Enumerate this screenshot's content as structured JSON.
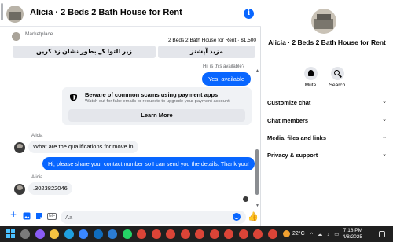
{
  "chat": {
    "title": "Alicia · 2 Beds 2 Bath House for Rent",
    "info_icon": "info-icon"
  },
  "marketplace": {
    "label": "Marketplace",
    "listing": "2 Beds 2 Bath House for Rent · $1,500",
    "btn_more": "مزید آپشنز",
    "btn_mark": "زیر التوا کے بطور نشان زد کریں"
  },
  "messages": {
    "seen_text": "Hi, is this available?",
    "yes_available": "Yes, available",
    "scam_title": "Beware of common scams using payment apps",
    "scam_sub": "Watch out for fake emails or requests to upgrade your payment account.",
    "learn_more": "Learn More",
    "sender_name": "Alicia",
    "question": "What are the qualifications for move in",
    "reply": "Hi, please share your contact number so I can send you the details. Thank you!",
    "number": ".3023822046"
  },
  "composer": {
    "placeholder": "Aa",
    "gif_label": "GIF",
    "like_icon": "thumbs-up-icon"
  },
  "info": {
    "title": "Alicia · 2 Beds 2 Bath House for Rent",
    "mute": "Mute",
    "search": "Search",
    "rows": [
      "Customize chat",
      "Chat members",
      "Media, files and links",
      "Privacy & support"
    ]
  },
  "taskbar": {
    "temperature": "22°C",
    "time": "7:18 PM",
    "date": "4/8/2025",
    "tray": "^ ☁ ♪ ▭",
    "apps": [
      {
        "name": "app-search",
        "color": "#7a7a7a"
      },
      {
        "name": "app-copilot",
        "color": "#8a5cf6"
      },
      {
        "name": "app-explorer",
        "color": "#f5c242"
      },
      {
        "name": "app-edge",
        "color": "#1fa0e0"
      },
      {
        "name": "app-store",
        "color": "#3a86ff"
      },
      {
        "name": "app-outlook",
        "color": "#0f6cbd"
      },
      {
        "name": "app-word",
        "color": "#2b7cd3"
      },
      {
        "name": "app-whatsapp",
        "color": "#25d366"
      },
      {
        "name": "app-chrome-1",
        "color": "#db4437"
      },
      {
        "name": "app-chrome-2",
        "color": "#db4437"
      },
      {
        "name": "app-chrome-3",
        "color": "#db4437"
      },
      {
        "name": "app-chrome-4",
        "color": "#db4437"
      },
      {
        "name": "app-chrome-5",
        "color": "#db4437"
      },
      {
        "name": "app-chrome-6",
        "color": "#db4437"
      },
      {
        "name": "app-chrome-7",
        "color": "#db4437"
      },
      {
        "name": "app-chrome-8",
        "color": "#db4437"
      },
      {
        "name": "app-chrome-9",
        "color": "#db4437"
      },
      {
        "name": "app-chrome-10",
        "color": "#db4437"
      }
    ]
  },
  "colors": {
    "accent": "#0866ff",
    "bubble_in": "#f0f2f5",
    "taskbar": "#202020"
  }
}
